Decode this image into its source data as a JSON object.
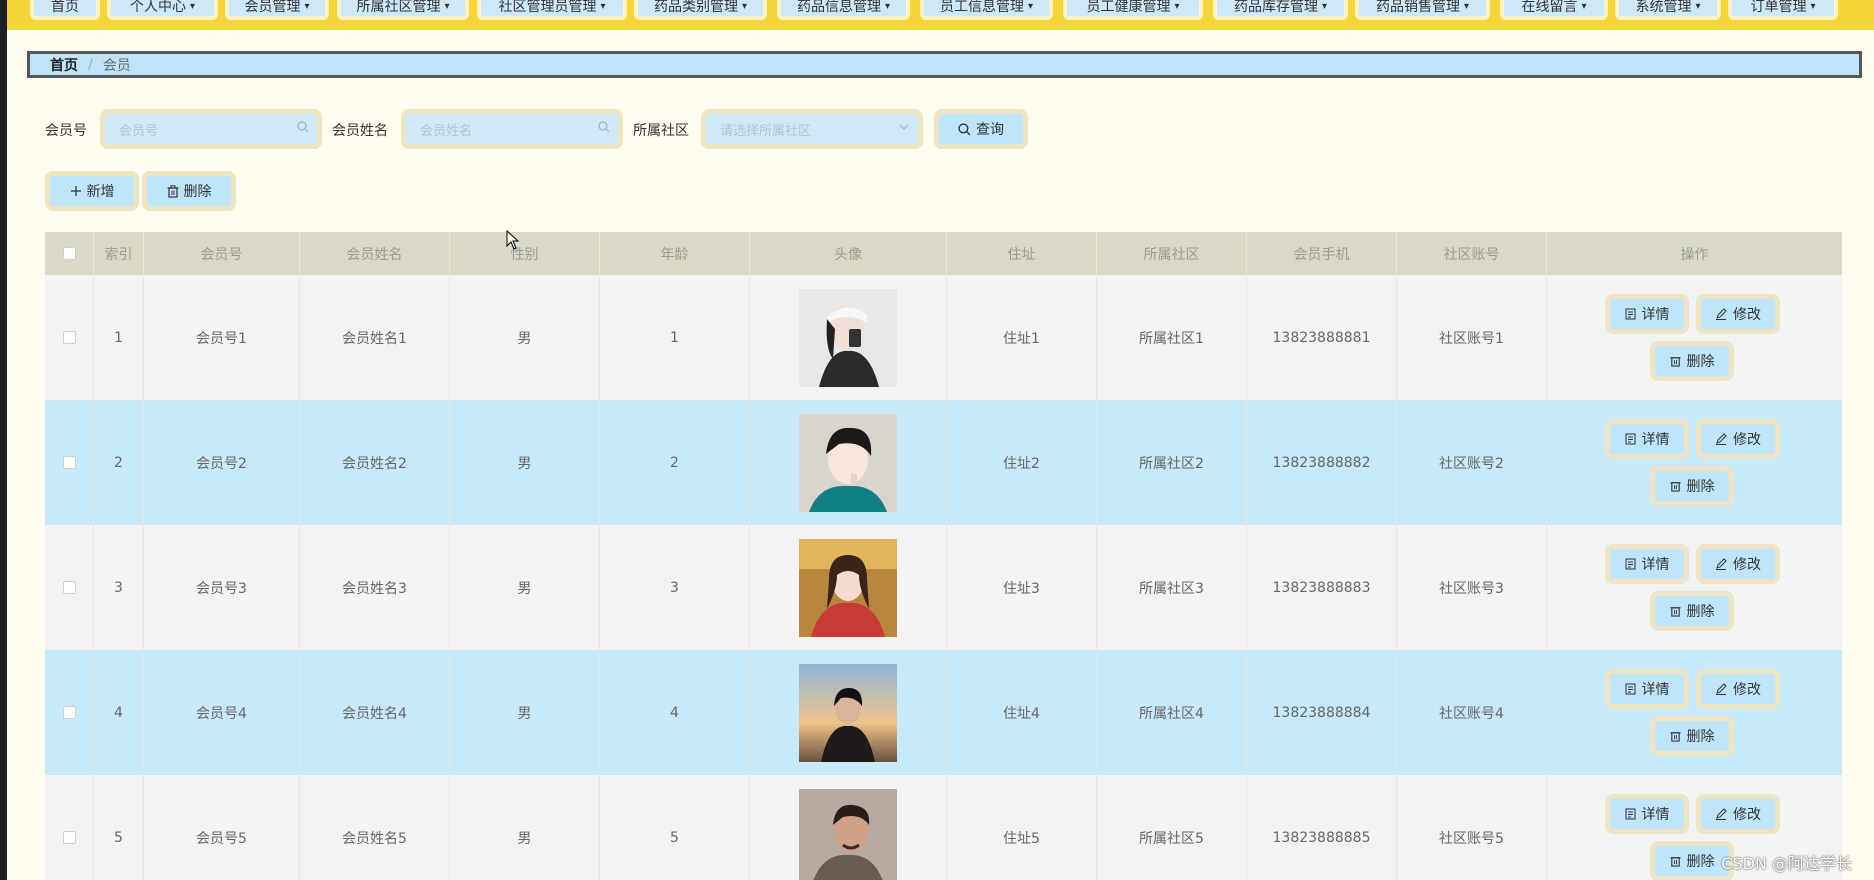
{
  "nav": {
    "items": [
      {
        "label": "首页"
      },
      {
        "label": "个人中心"
      },
      {
        "label": "会员管理"
      },
      {
        "label": "所属社区管理"
      },
      {
        "label": "社区管理员管理"
      },
      {
        "label": "药品类别管理"
      },
      {
        "label": "药品信息管理"
      },
      {
        "label": "员工信息管理"
      },
      {
        "label": "员工健康管理"
      },
      {
        "label": "药品库存管理"
      },
      {
        "label": "药品销售管理"
      },
      {
        "label": "在线留言"
      },
      {
        "label": "系统管理"
      },
      {
        "label": "订单管理"
      }
    ]
  },
  "breadcrumb": {
    "home": "首页",
    "separator": "/",
    "current": "会员"
  },
  "search": {
    "member_no_label": "会员号",
    "member_no_placeholder": "会员号",
    "member_name_label": "会员姓名",
    "member_name_placeholder": "会员姓名",
    "community_label": "所属社区",
    "community_placeholder": "请选择所属社区",
    "query_label": "查询"
  },
  "actions": {
    "add_label": "新增",
    "delete_label": "删除"
  },
  "table": {
    "headers": [
      "索引",
      "会员号",
      "会员姓名",
      "性别",
      "年龄",
      "头像",
      "住址",
      "所属社区",
      "会员手机",
      "社区账号",
      "操作"
    ],
    "row_actions": {
      "detail": "详情",
      "edit": "修改",
      "delete": "删除"
    },
    "rows": [
      {
        "index": "1",
        "member_no": "会员号1",
        "member_name": "会员姓名1",
        "gender": "男",
        "age": "1",
        "address": "住址1",
        "community": "所属社区1",
        "phone": "13823888881",
        "account": "社区账号1"
      },
      {
        "index": "2",
        "member_no": "会员号2",
        "member_name": "会员姓名2",
        "gender": "男",
        "age": "2",
        "address": "住址2",
        "community": "所属社区2",
        "phone": "13823888882",
        "account": "社区账号2"
      },
      {
        "index": "3",
        "member_no": "会员号3",
        "member_name": "会员姓名3",
        "gender": "男",
        "age": "3",
        "address": "住址3",
        "community": "所属社区3",
        "phone": "13823888883",
        "account": "社区账号3"
      },
      {
        "index": "4",
        "member_no": "会员号4",
        "member_name": "会员姓名4",
        "gender": "男",
        "age": "4",
        "address": "住址4",
        "community": "所属社区4",
        "phone": "13823888884",
        "account": "社区账号4"
      },
      {
        "index": "5",
        "member_no": "会员号5",
        "member_name": "会员姓名5",
        "gender": "男",
        "age": "5",
        "address": "住址5",
        "community": "所属社区5",
        "phone": "13823888885",
        "account": "社区账号5"
      }
    ]
  },
  "watermark": "CSDN @阿达学长",
  "colors": {
    "nav_bg": "#f5d63a",
    "button_bg": "#bfe5fa",
    "row_alt_bg": "#c7e9fa",
    "header_bg": "#d9d9c5",
    "page_bg": "#fffdf0"
  }
}
